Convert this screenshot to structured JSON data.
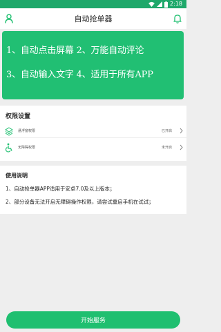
{
  "status_bar": {
    "time": "2:18"
  },
  "app_bar": {
    "title": "自动抢单器"
  },
  "banner": {
    "line1": "1、自动点击屏幕 2、万能自动评论",
    "line2": "3、自动输入文字 4、适用于所有APP"
  },
  "permissions": {
    "title": "权限设置",
    "items": [
      {
        "label": "悬浮窗权限",
        "status": "已开启",
        "icon": "layers-icon"
      },
      {
        "label": "无障碍权限",
        "status": "未开启",
        "icon": "accessibility-icon"
      }
    ]
  },
  "usage": {
    "title": "使用说明",
    "items": [
      "1、自动抢单器APP适用于安卓7.0及以上版本；",
      "2、部分设备无法开启无障碍操作权限，请尝试重启手机在试试；"
    ]
  },
  "start_button": {
    "label": "开始服务"
  },
  "colors": {
    "accent": "#1fbf70",
    "status_bar": "#1ea86a"
  }
}
